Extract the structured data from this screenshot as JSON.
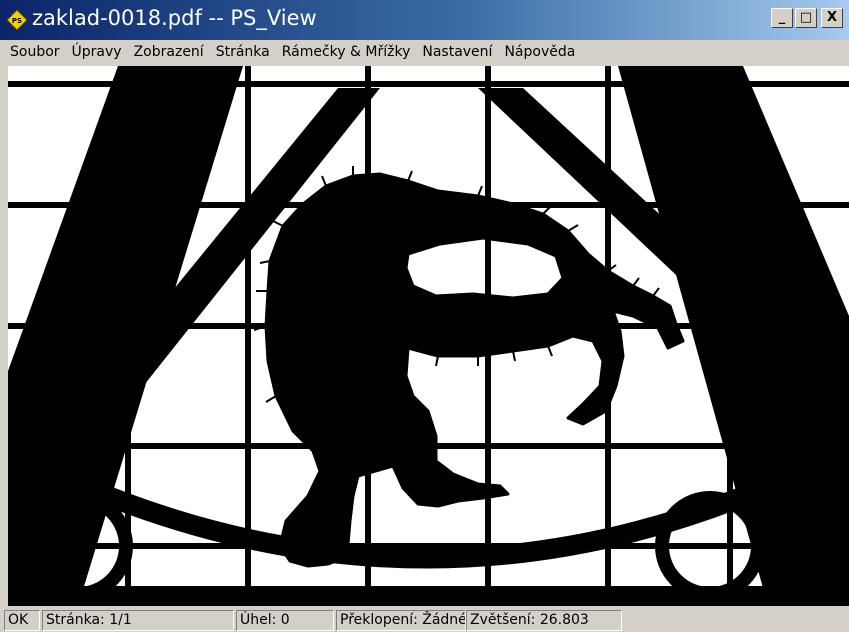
{
  "window": {
    "title": "zaklad-0018.pdf -- PS_View",
    "buttons": {
      "minimize": "_",
      "maximize": "□",
      "close": "X"
    }
  },
  "menu": [
    {
      "label": "Soubor"
    },
    {
      "label": "Úpravy"
    },
    {
      "label": "Zobrazení"
    },
    {
      "label": "Stránka"
    },
    {
      "label": "Rámečky & Mřížky"
    },
    {
      "label": "Nastavení"
    },
    {
      "label": "Nápověda"
    }
  ],
  "document": {
    "content": "black-and-white silhouette illustration: monkey hanging in a barred cage"
  },
  "status": {
    "ok": "OK",
    "page": "Stránka: 1/1",
    "angle": "Úhel: 0",
    "flip": "Překlopení: Žádné",
    "zoom": "Zvětšení: 26.803"
  },
  "colors": {
    "titlebar_start": "#0a246a",
    "titlebar_end": "#a6caf0",
    "chrome": "#d4d0c8",
    "ink": "#000000",
    "paper": "#ffffff"
  }
}
